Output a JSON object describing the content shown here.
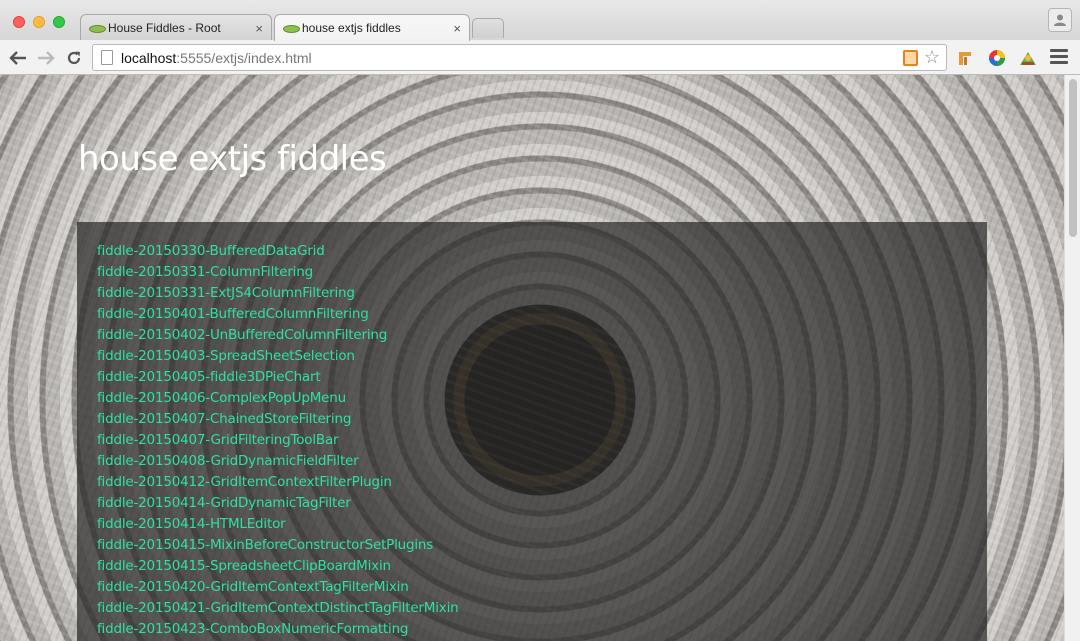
{
  "browser": {
    "tabs": [
      {
        "title": "House Fiddles - Root",
        "active": false,
        "close": "×"
      },
      {
        "title": "house extjs fiddles",
        "active": true,
        "close": "×"
      }
    ],
    "address": {
      "host": "localhost",
      "path": ":5555/extjs/index.html"
    },
    "icons": [
      "back-arrow-icon",
      "forward-arrow-icon",
      "reload-icon",
      "page-icon",
      "rss-icon",
      "bookmark-star-icon",
      "extension-icon",
      "color-wheel-icon",
      "extension-icon",
      "menu-icon",
      "profile-icon"
    ]
  },
  "page": {
    "title": "house extjs fiddles",
    "fiddles": [
      "fiddle-20150330-BufferedDataGrid",
      "fiddle-20150331-ColumnFiltering",
      "fiddle-20150331-ExtJS4ColumnFiltering",
      "fiddle-20150401-BufferedColumnFiltering",
      "fiddle-20150402-UnBufferedColumnFiltering",
      "fiddle-20150403-SpreadSheetSelection",
      "fiddle-20150405-fiddle3DPieChart",
      "fiddle-20150406-ComplexPopUpMenu",
      "fiddle-20150407-ChainedStoreFiltering",
      "fiddle-20150407-GridFilteringToolBar",
      "fiddle-20150408-GridDynamicFieldFilter",
      "fiddle-20150412-GridItemContextFilterPlugin",
      "fiddle-20150414-GridDynamicTagFilter",
      "fiddle-20150414-HTMLEditor",
      "fiddle-20150415-MixinBeforeConstructorSetPlugins",
      "fiddle-20150415-SpreadsheetClipBoardMixin",
      "fiddle-20150420-GridItemContextTagFilterMixin",
      "fiddle-20150421-GridItemContextDistinctTagFilterMixin",
      "fiddle-20150423-ComboBoxNumericFormatting"
    ]
  },
  "colors": {
    "link": "#2fe0a2",
    "title": "#ffffff"
  }
}
